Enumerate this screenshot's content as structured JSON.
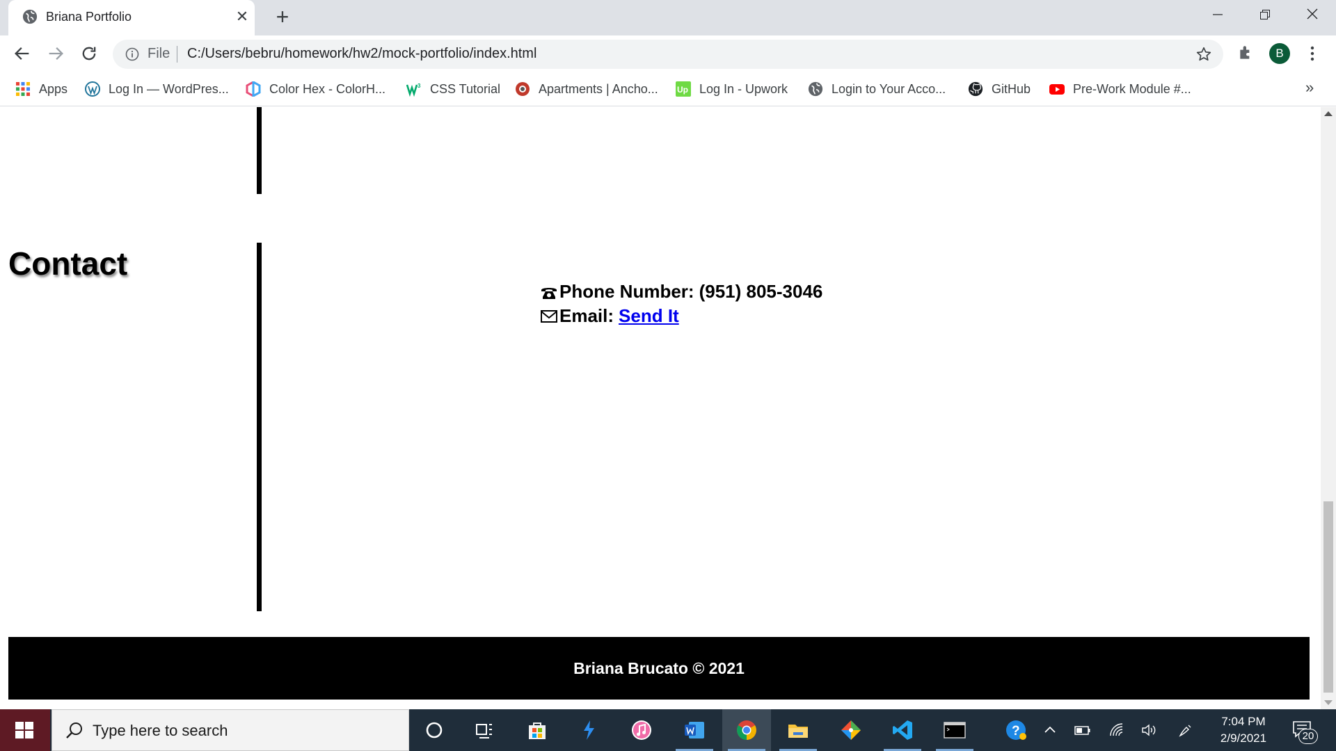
{
  "browser": {
    "tab_title": "Briana Portfolio",
    "new_tab_symbol": "+",
    "close_tab_symbol": "✕",
    "omnibox": {
      "scheme_label": "File",
      "url": "C:/Users/bebru/homework/hw2/mock-portfolio/index.html"
    },
    "profile_initial": "B",
    "bookmarks": [
      {
        "label": "Apps",
        "icon": "apps-grid-icon"
      },
      {
        "label": "Log In — WordPres...",
        "icon": "wordpress-icon"
      },
      {
        "label": "Color Hex - ColorH...",
        "icon": "colorhex-icon"
      },
      {
        "label": "CSS Tutorial",
        "icon": "w3schools-icon"
      },
      {
        "label": "Apartments | Ancho...",
        "icon": "apartments-icon"
      },
      {
        "label": "Log In - Upwork",
        "icon": "upwork-icon"
      },
      {
        "label": "Login to Your Acco...",
        "icon": "globe-icon"
      },
      {
        "label": "GitHub",
        "icon": "github-icon"
      },
      {
        "label": "Pre-Work Module #...",
        "icon": "youtube-icon"
      }
    ],
    "bookmarks_overflow": "»"
  },
  "page": {
    "contact_heading": "Contact",
    "phone_label": "Phone Number:",
    "phone_value": "(951) 805-3046",
    "email_label": "Email:",
    "email_link_text": "Send It",
    "footer_text": "Briana Brucato © 2021"
  },
  "taskbar": {
    "search_placeholder": "Type here to search",
    "time": "7:04 PM",
    "date": "2/9/2021",
    "notification_count": "20",
    "apps": [
      "cortana-icon",
      "task-view-icon",
      "store-icon",
      "app-bolt-icon",
      "itunes-icon",
      "word-icon",
      "chrome-icon",
      "file-explorer-icon",
      "git-icon",
      "vscode-icon",
      "terminal-icon"
    ]
  },
  "colors": {
    "tabstrip_bg": "#dee1e6",
    "link": "#0000ee",
    "footer_bg": "#000000",
    "taskbar_bg": "#1f2d3a",
    "profile_bg": "#0b5b38"
  }
}
